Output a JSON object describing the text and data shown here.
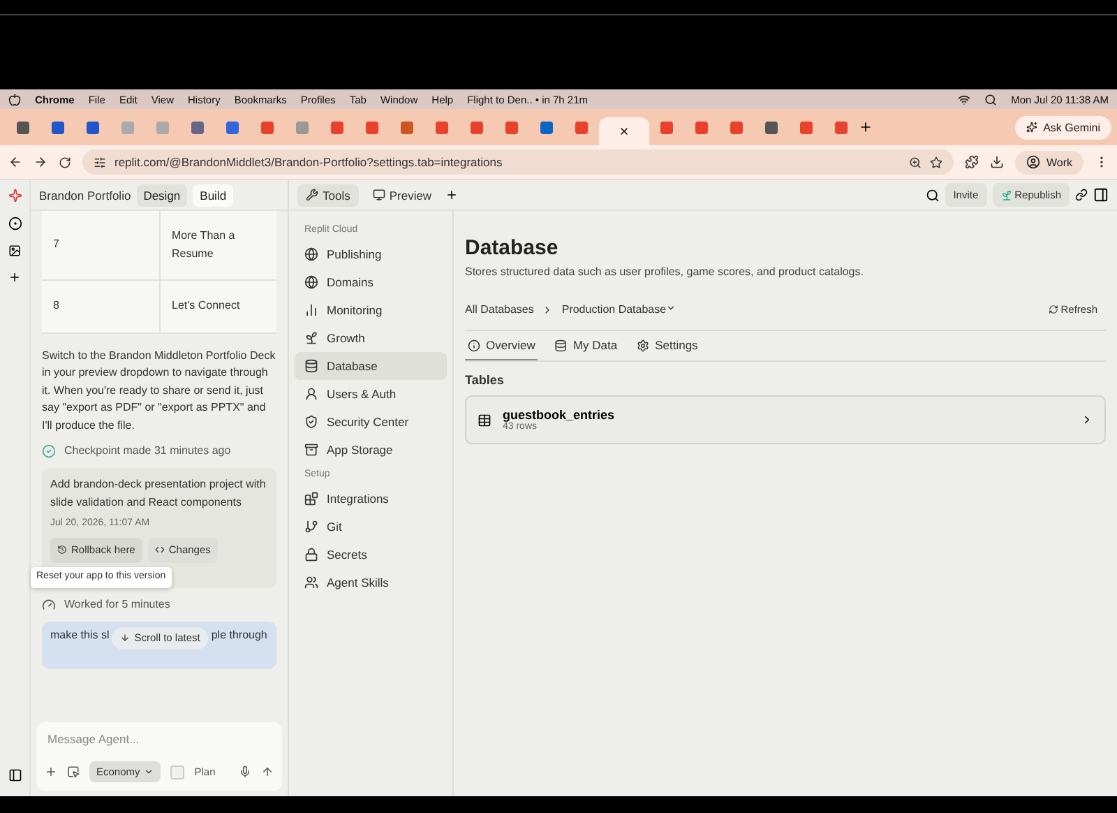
{
  "menubar": {
    "app": "Chrome",
    "menus": [
      "File",
      "Edit",
      "View",
      "History",
      "Bookmarks",
      "Profiles",
      "Tab",
      "Window",
      "Help"
    ],
    "event": "Flight to Den.. • in 7h 21m",
    "clock": "Mon Jul 20  11:38 AM"
  },
  "browser_tabs": [
    {
      "color": "#555555",
      "selected": false
    },
    {
      "color": "#2255cc",
      "selected": false
    },
    {
      "color": "#2255cc",
      "selected": false
    },
    {
      "color": "#aaaaaa",
      "selected": false
    },
    {
      "color": "#aaaaaa",
      "selected": false
    },
    {
      "color": "#666688",
      "selected": false
    },
    {
      "color": "#3366dd",
      "selected": false
    },
    {
      "color": "#e8412c",
      "selected": false
    },
    {
      "color": "#999999",
      "selected": false
    },
    {
      "color": "#e8412c",
      "selected": false
    },
    {
      "color": "#e8412c",
      "selected": false
    },
    {
      "color": "#cc5522",
      "selected": false
    },
    {
      "color": "#e8412c",
      "selected": false
    },
    {
      "color": "#e8412c",
      "selected": false
    },
    {
      "color": "#e8412c",
      "selected": false
    },
    {
      "color": "#0a66c2",
      "selected": false
    },
    {
      "color": "#e8412c",
      "selected": false
    },
    {
      "color": "#fdeee7",
      "selected": true
    },
    {
      "color": "#e8412c",
      "selected": false
    },
    {
      "color": "#e8412c",
      "selected": false
    },
    {
      "color": "#e8412c",
      "selected": false
    },
    {
      "color": "#555555",
      "selected": false
    },
    {
      "color": "#e8412c",
      "selected": false
    },
    {
      "color": "#e8412c",
      "selected": false
    }
  ],
  "ask_button": "Ask Gemini",
  "address": "replit.com/@BrandonMiddlet3/Brandon-Portfolio?settings.tab=integrations",
  "profile": "Work",
  "project": {
    "name": "Brandon Portfolio",
    "modes": [
      {
        "label": "Design",
        "selected": false
      },
      {
        "label": "Build",
        "selected": true
      }
    ]
  },
  "slides_table": [
    {
      "number": "7",
      "title": "More Than a Resume"
    },
    {
      "number": "8",
      "title": "Let's Connect"
    }
  ],
  "agent_message": "Switch to the Brandon Middleton Portfolio Deck in your preview dropdown to navigate through it. When you're ready to share or send it, just say \"export as PDF\" or \"export as PPTX\" and I'll produce the file.",
  "checkpoint": {
    "label": "Checkpoint made 31 minutes ago",
    "title": "Add brandon-deck presentation project with slide validation and React components",
    "date": "Jul 20, 2026, 11:07 AM",
    "actions": [
      "Rollback here",
      "Changes"
    ],
    "tooltip": "Reset your app to this version"
  },
  "worked": "Worked for 5 minutes",
  "user_message": {
    "start": "make this sl",
    "end": "ple through"
  },
  "scroll_button": "Scroll to latest",
  "composer": {
    "placeholder": "Message Agent...",
    "mode": "Economy",
    "plan_label": "Plan",
    "plan_checked": false
  },
  "workspace_tabs": [
    {
      "label": "Tools",
      "selected": true
    },
    {
      "label": "Preview",
      "selected": false
    }
  ],
  "header_buttons": [
    "Invite",
    "Republish"
  ],
  "tools_nav": [
    {
      "heading": "Replit Cloud",
      "items": [
        {
          "label": "Publishing",
          "selected": false
        },
        {
          "label": "Domains",
          "selected": false
        },
        {
          "label": "Monitoring",
          "selected": false
        },
        {
          "label": "Growth",
          "selected": false
        },
        {
          "label": "Database",
          "selected": true
        },
        {
          "label": "Users & Auth",
          "selected": false
        },
        {
          "label": "Security Center",
          "selected": false
        },
        {
          "label": "App Storage",
          "selected": false
        }
      ]
    },
    {
      "heading": "Setup",
      "items": [
        {
          "label": "Integrations",
          "selected": false
        },
        {
          "label": "Git",
          "selected": false
        },
        {
          "label": "Secrets",
          "selected": false
        },
        {
          "label": "Agent Skills",
          "selected": false
        }
      ]
    }
  ],
  "database": {
    "title": "Database",
    "description": "Stores structured data such as user profiles, game scores, and product catalogs.",
    "breadcrumb": [
      "All Databases",
      "Production Database"
    ],
    "refresh": "Refresh",
    "tabs": [
      {
        "label": "Overview",
        "selected": true
      },
      {
        "label": "My Data",
        "selected": false
      },
      {
        "label": "Settings",
        "selected": false
      }
    ],
    "tables_heading": "Tables",
    "tables": [
      {
        "name": "guestbook_entries",
        "rows": "43 rows"
      }
    ]
  }
}
